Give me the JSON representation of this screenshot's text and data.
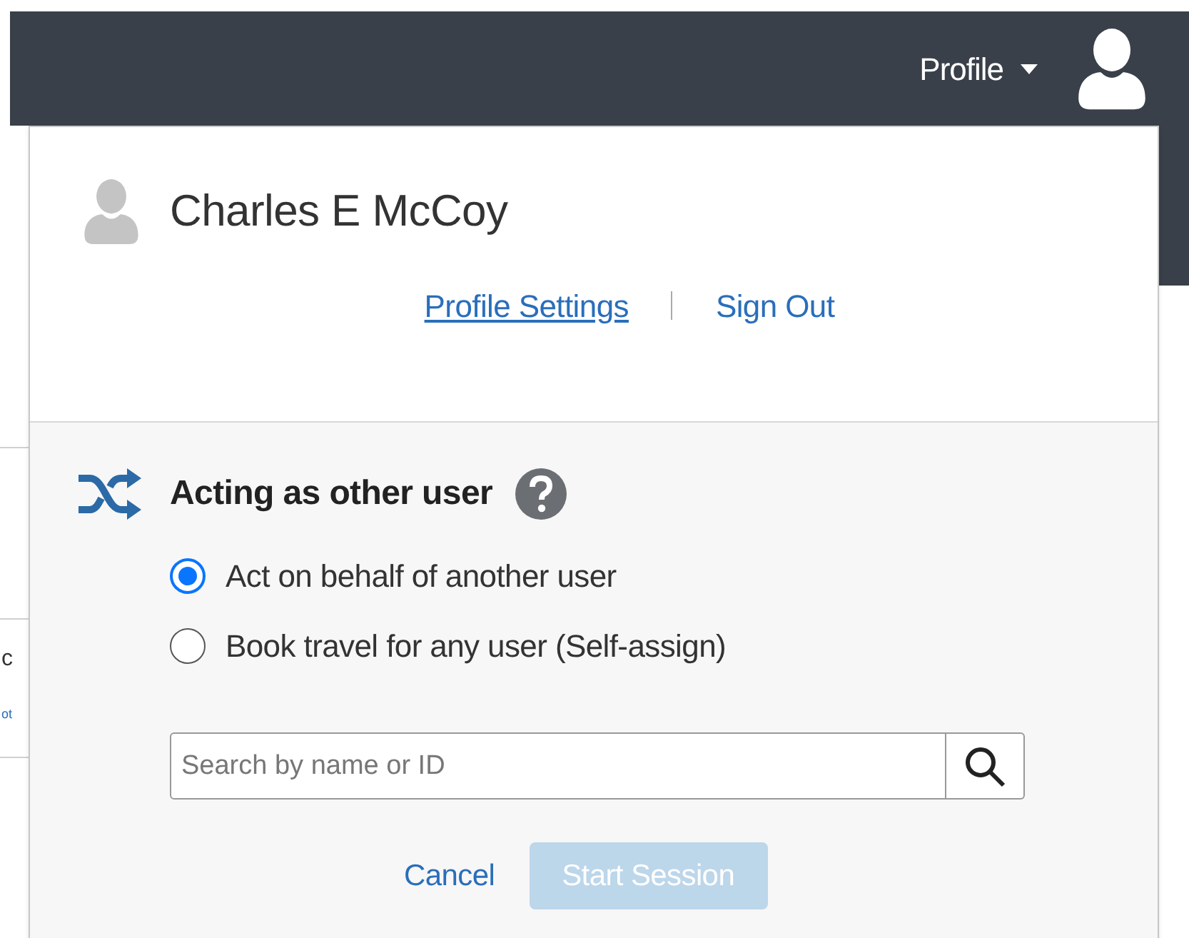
{
  "header": {
    "menu_label": "Profile"
  },
  "background": {
    "fragments": [
      "c",
      "ot"
    ]
  },
  "profile_menu": {
    "user_name": "Charles E McCoy",
    "links": [
      {
        "label": "Profile Settings",
        "hovered": true
      },
      {
        "label": "Sign Out",
        "hovered": false
      }
    ],
    "acting_as": {
      "title": "Acting as other user",
      "options": [
        {
          "label": "Act on behalf of another user",
          "selected": true
        },
        {
          "label": "Book travel for any user (Self-assign)",
          "selected": false
        }
      ],
      "search": {
        "placeholder": "Search by name or ID"
      },
      "actions": [
        {
          "label": "Cancel",
          "kind": "link",
          "disabled": false
        },
        {
          "label": "Start Session",
          "kind": "button",
          "disabled": true
        }
      ]
    }
  }
}
